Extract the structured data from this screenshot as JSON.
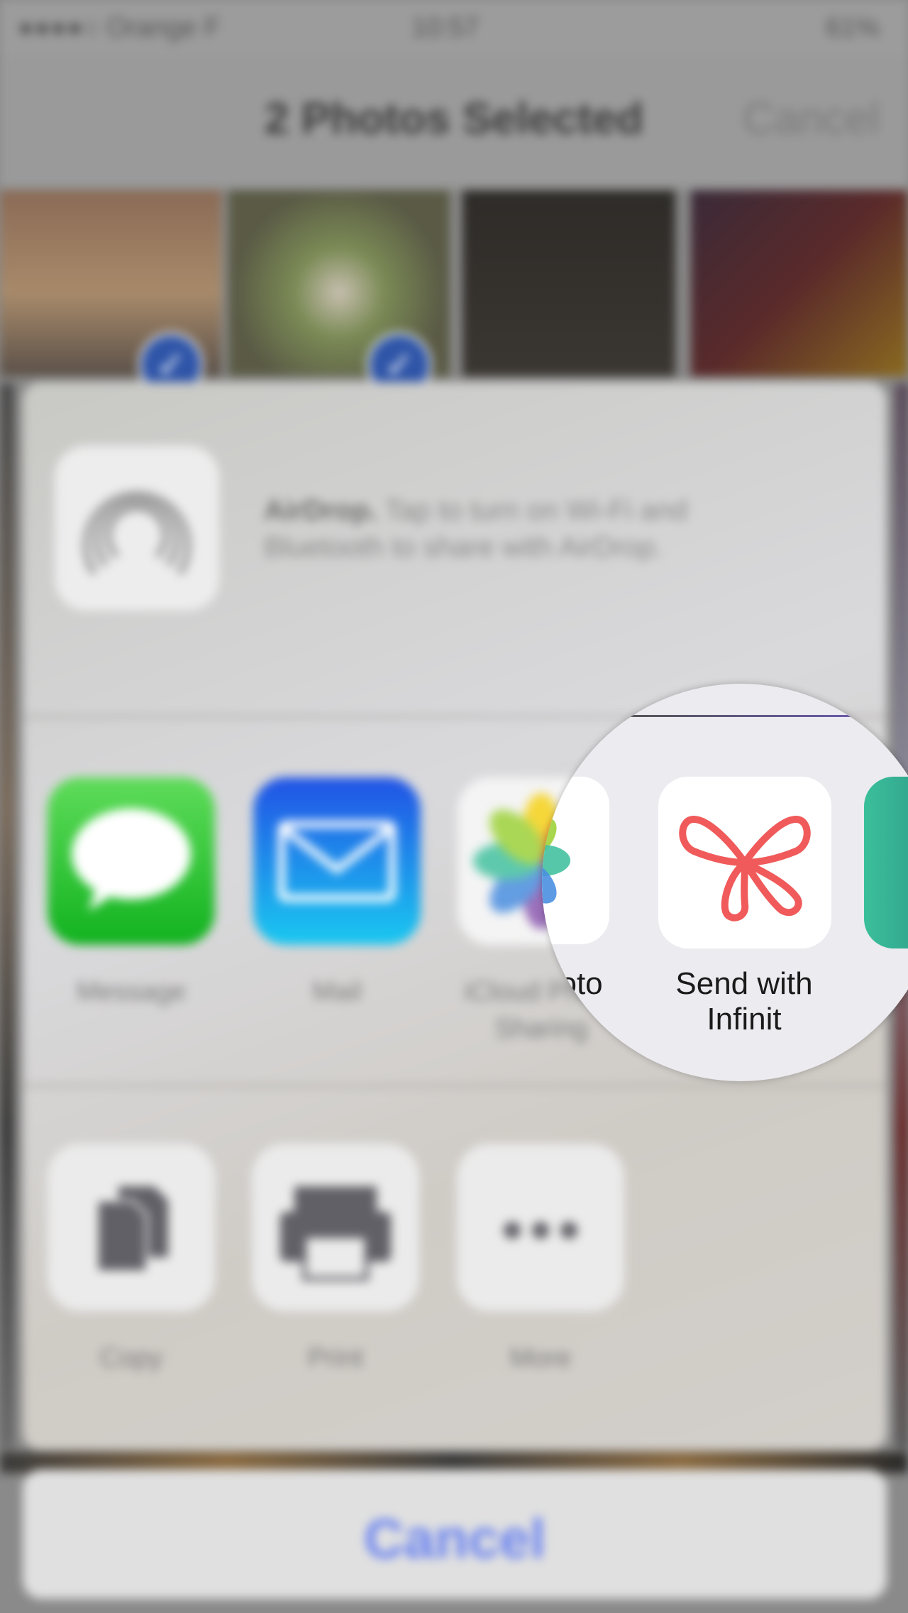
{
  "status_bar": {
    "signal": "●●●●○",
    "carrier": "Orange F",
    "time": "10:57",
    "battery": "61%"
  },
  "nav": {
    "title": "2 Photos Selected",
    "cancel": "Cancel"
  },
  "airdrop": {
    "title": "AirDrop.",
    "text": "Tap to turn on Wi-Fi and Bluetooth to share with AirDrop."
  },
  "share_apps": [
    {
      "label": "Message",
      "icon": "message-icon"
    },
    {
      "label": "Mail",
      "icon": "mail-icon"
    },
    {
      "label_line1": "iCloud Photo",
      "label_line2": "Sharing",
      "icon": "photos-icon"
    }
  ],
  "actions": [
    {
      "label": "Copy",
      "icon": "copy-icon"
    },
    {
      "label": "Print",
      "icon": "print-icon"
    },
    {
      "label": "More",
      "icon": "more-icon"
    }
  ],
  "cancel_button": "Cancel",
  "magnifier": {
    "photo_label": "hoto",
    "infinit_label_line1": "Send with",
    "infinit_label_line2": "Infinit"
  },
  "colors": {
    "accent": "#6a83f0",
    "infinit": "#f05a5a",
    "checkmark": "#2f55a8"
  }
}
